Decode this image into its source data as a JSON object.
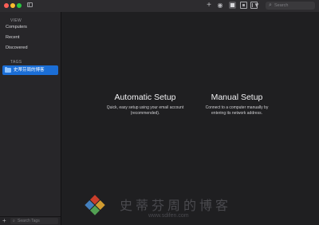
{
  "toolbar": {
    "search_placeholder": "Search",
    "icons": [
      "sidebar-toggle-icon",
      "plus-icon",
      "eye-icon",
      "icon-view",
      "list-view",
      "column-view",
      "filter-icon",
      "search-icon"
    ]
  },
  "sidebar": {
    "view_header": "VIEW",
    "items": [
      {
        "label": "Computers"
      },
      {
        "label": "Recent"
      },
      {
        "label": "Discovered"
      }
    ],
    "tags_header": "TAGS",
    "tags": [
      {
        "label": "史蒂芬周的博客",
        "selected": true
      }
    ],
    "search_placeholder": "Search Tags"
  },
  "main": {
    "automatic": {
      "title": "Automatic Setup",
      "desc_line1": "Quick, easy setup using your email account",
      "desc_line2": "(recommended)."
    },
    "manual": {
      "title": "Manual Setup",
      "desc_line1": "Connect to a computer manually by",
      "desc_line2": "entering its network address."
    }
  },
  "watermark": {
    "text": "史蒂芬周的博客",
    "url": "www.sdifen.com"
  },
  "colors": {
    "accent": "#1b6ed6",
    "window_bg": "#1f1f21",
    "sidebar_bg": "#272629"
  }
}
